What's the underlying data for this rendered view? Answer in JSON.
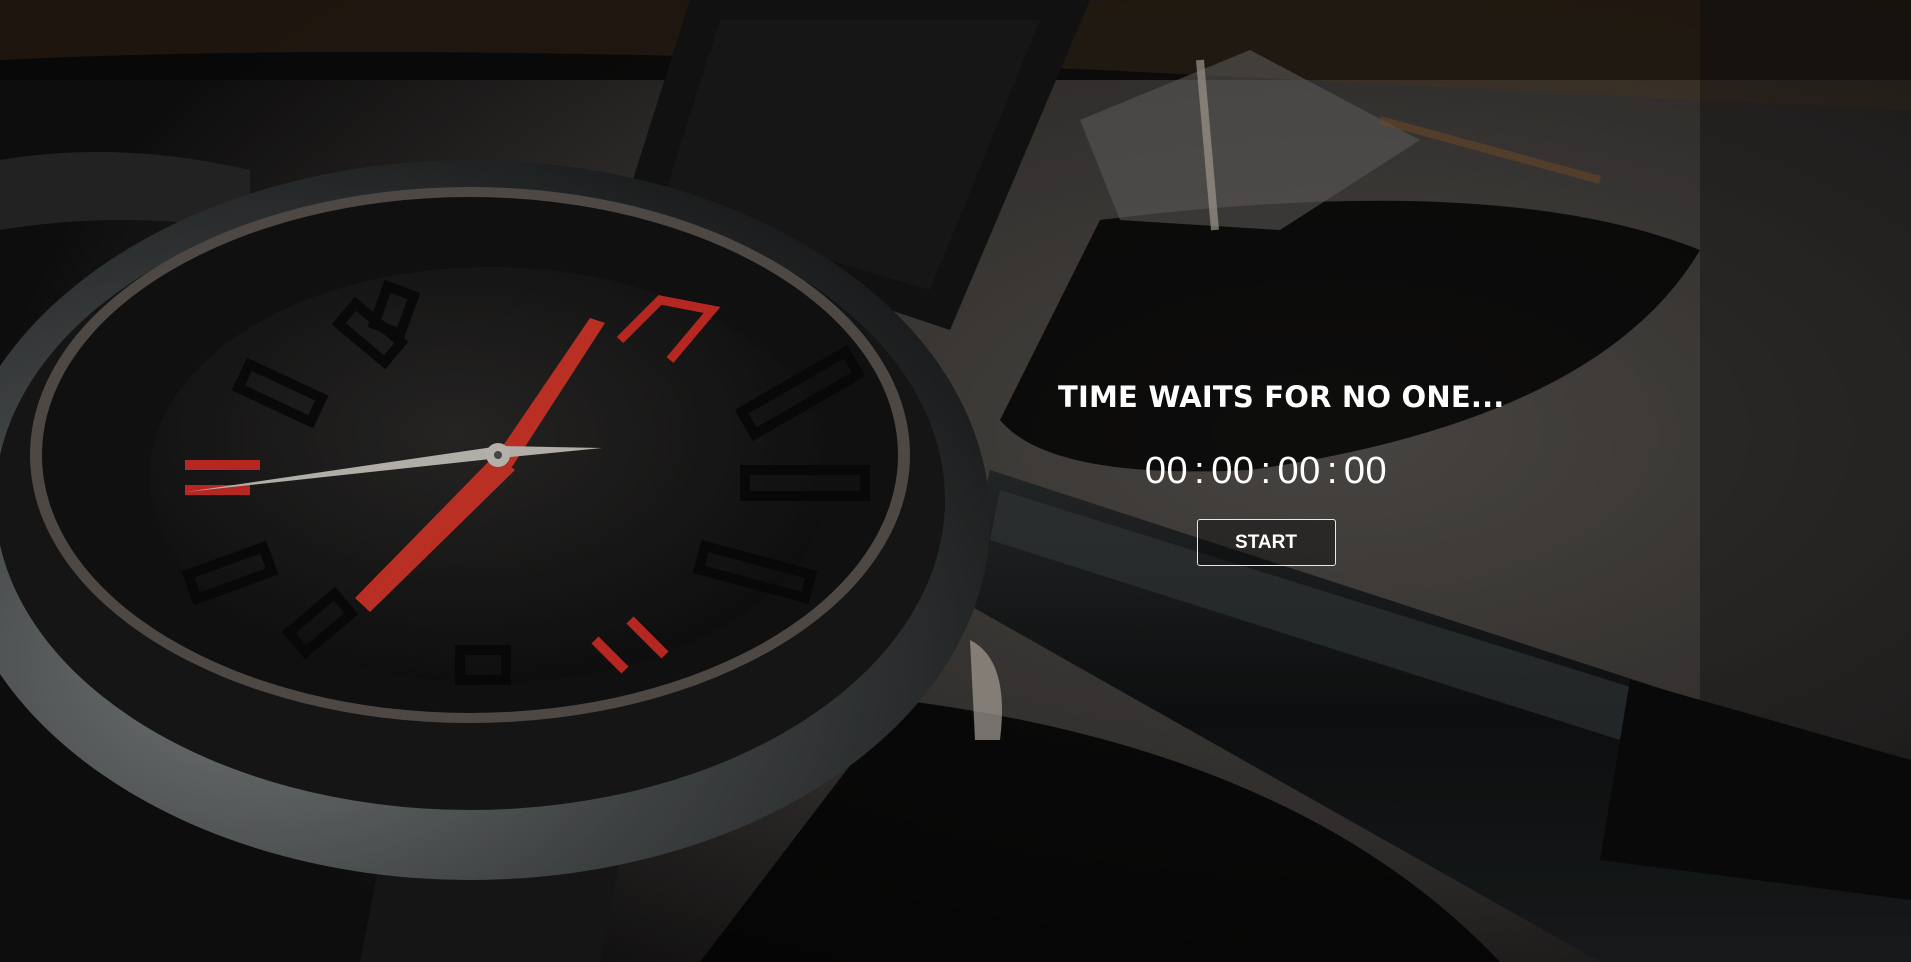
{
  "page": {
    "headline": "TIME WAITS FOR NO ONE...",
    "start_label": "START"
  },
  "countdown": {
    "days": "00",
    "hours": "00",
    "minutes": "00",
    "seconds": "00",
    "separator": ":"
  },
  "background": {
    "subject": "wristwatch-and-pen-photo",
    "accent_color": "#e0302a"
  }
}
